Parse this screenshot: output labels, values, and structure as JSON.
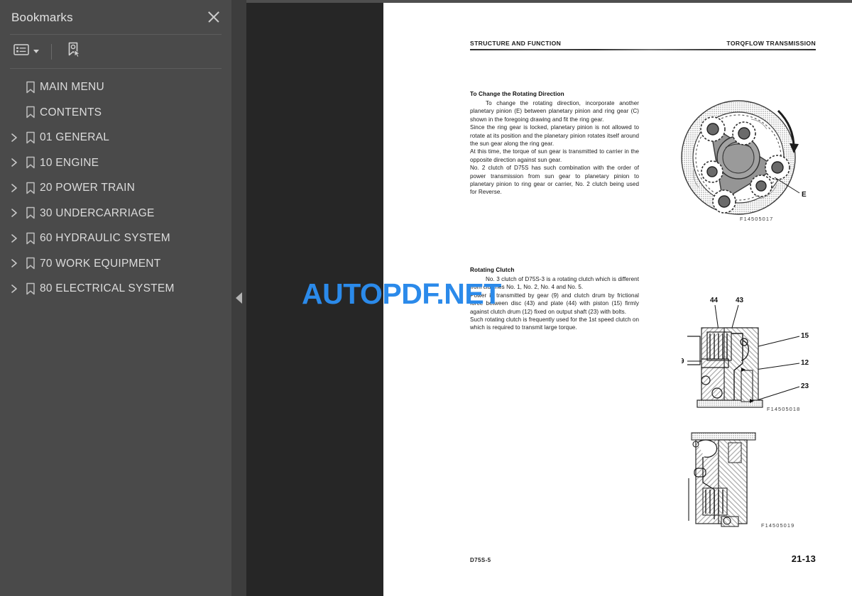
{
  "sidebar": {
    "title": "Bookmarks",
    "close_label": "Close",
    "toolbar": {
      "options_label": "Bookmark options",
      "expand_label": "Expand current bookmark"
    },
    "items": [
      {
        "label": "MAIN MENU",
        "expandable": false
      },
      {
        "label": "CONTENTS",
        "expandable": false
      },
      {
        "label": "01 GENERAL",
        "expandable": true
      },
      {
        "label": "10 ENGINE",
        "expandable": true
      },
      {
        "label": "20 POWER TRAIN",
        "expandable": true
      },
      {
        "label": "30 UNDERCARRIAGE",
        "expandable": true
      },
      {
        "label": "60 HYDRAULIC SYSTEM",
        "expandable": true
      },
      {
        "label": "70 WORK EQUIPMENT",
        "expandable": true
      },
      {
        "label": "80 ELECTRICAL SYSTEM",
        "expandable": true
      }
    ]
  },
  "splitter": {
    "collapse_label": "Collapse sidebar"
  },
  "watermark": {
    "text": "AUTOPDF.NET",
    "color": "#2b8aea"
  },
  "page": {
    "header": {
      "left": "STRUCTURE AND FUNCTION",
      "right": "TORQFLOW TRANSMISSION"
    },
    "sections": [
      {
        "title": "To Change the Rotating Direction",
        "paragraphs": [
          "To change the rotating direction, incorporate another planetary pinion (E) between planetary pinion and ring gear (C) shown in the foregoing drawing and fit the ring gear.",
          "Since the ring gear is locked, planetary pinion is not allowed to rotate at its position and the planetary pinion rotates itself around the sun gear along the ring gear.",
          "At this time, the torque of sun gear is transmitted to carrier in the opposite direction against sun gear.",
          "No. 2 clutch of D75S has such combination with the order of power transmission from sun gear to planetary pinion to planetary pinion to ring gear or carrier, No. 2 clutch being used for Reverse."
        ]
      },
      {
        "title": "Rotating Clutch",
        "paragraphs": [
          "No. 3 clutch of D75S-3 is a rotating clutch which is different from clutches No. 1, No. 2, No. 4 and No. 5.",
          "Power is transmitted by gear (9) and clutch drum by frictional force between disc (43) and plate (44) with piston (15) firmly against clutch drum (12) fixed on output shaft (23) with bolts.",
          "Such rotating clutch is frequently used for the 1st speed clutch on which is required to transmit large torque."
        ]
      }
    ],
    "figures": [
      {
        "id": "F14505017",
        "caption": "planetary-gear-set-diagram",
        "callouts": [
          "E"
        ]
      },
      {
        "id": "F14505018",
        "caption": "rotating-clutch-section-diagram",
        "callouts": [
          "44",
          "43",
          "15",
          "12",
          "23",
          "9"
        ]
      },
      {
        "id": "F14505019",
        "caption": "clutch-assembly-section-diagram",
        "callouts": []
      }
    ],
    "footer": {
      "left": "D75S-5",
      "right": "21-13"
    }
  }
}
